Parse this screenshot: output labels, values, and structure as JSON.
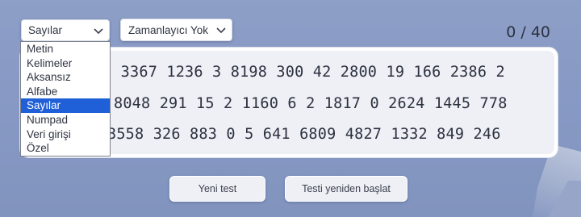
{
  "toolbar": {
    "mode_value": "Sayılar",
    "timer_value": "Zamanlayıcı Yok",
    "counter": "0 / 40"
  },
  "dropdown": {
    "options": [
      "Metin",
      "Kelimeler",
      "Aksansız",
      "Alfabe",
      "Sayılar",
      "Numpad",
      "Veri girişi",
      "Özel"
    ],
    "selected": "Sayılar"
  },
  "text_panel": {
    "lines": [
      "0 3367 1236 3 8198 300 42 2800 19 166 2386 2",
      "8048 291 15 2 1160 6 2 1817 0 2624 1445 778",
      "3558 326 883 0 5 641 6809 4827 1332 849 246"
    ]
  },
  "buttons": {
    "new_test": "Yeni test",
    "restart_test": "Testi yeniden başlat"
  },
  "colors": {
    "selected_option": "#1f5fd8",
    "background": "#8799c4"
  }
}
